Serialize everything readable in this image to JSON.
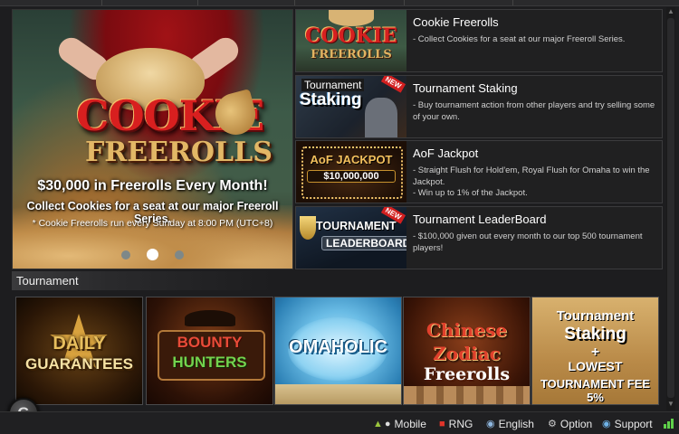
{
  "hero": {
    "logo_top": "COOKIE",
    "logo_bottom": "FREEROLLS",
    "line1": "$30,000 in Freerolls Every Month!",
    "line2": "Collect Cookies for a seat at our major Freeroll Series.",
    "line3": "* Cookie Freerolls run every Sunday at 8:00 PM (UTC+8)",
    "carousel_active_index": 2
  },
  "promotions": [
    {
      "title": "Cookie Freerolls",
      "thumb_text": [
        "COOKIE",
        "FREEROLLS"
      ],
      "desc": [
        "- Collect Cookies for a seat at our major Freeroll Series."
      ]
    },
    {
      "title": "Tournament Staking",
      "thumb_text": [
        "Tournament",
        "Staking",
        "NEW"
      ],
      "desc": [
        "- Buy tournament action from other players and try selling some of your own."
      ]
    },
    {
      "title": "AoF Jackpot",
      "thumb_text": [
        "AoF JACKPOT",
        "$10,000,000"
      ],
      "desc": [
        "- Straight Flush for Hold'em, Royal Flush for Omaha to win the Jackpot.",
        "- Win up to 1% of the Jackpot."
      ]
    },
    {
      "title": "Tournament LeaderBoard",
      "thumb_text": [
        "TOURNAMENT",
        "LEADERBOARD",
        "NEW"
      ],
      "desc": [
        "- $100,000 given out every month to our top 500 tournament players!"
      ]
    }
  ],
  "section": {
    "title": "Tournament"
  },
  "tiles": [
    {
      "lines": [
        "DAILY",
        "GUARANTEES"
      ]
    },
    {
      "lines": [
        "BOUNTY",
        "HUNTERS"
      ]
    },
    {
      "lines": [
        "OMAHOLIC"
      ]
    },
    {
      "lines": [
        "Chinese",
        "Zodiac",
        "Freerolls"
      ]
    },
    {
      "lines": [
        "Tournament",
        "Staking",
        "+",
        "LOWEST",
        "TOURNAMENT FEE 5%"
      ]
    }
  ],
  "footer": {
    "g_button": "G",
    "items": [
      {
        "label": "Mobile",
        "icon": "mobile-icon"
      },
      {
        "label": "RNG",
        "icon": "dice-icon"
      },
      {
        "label": "English",
        "icon": "globe-icon"
      },
      {
        "label": "Option",
        "icon": "gear-icon"
      },
      {
        "label": "Support",
        "icon": "support-icon"
      }
    ]
  },
  "colors": {
    "background": "#1d1d1f",
    "panel": "#202021",
    "accent_red": "#d21f1f",
    "signal_green": "#5fd04a"
  }
}
